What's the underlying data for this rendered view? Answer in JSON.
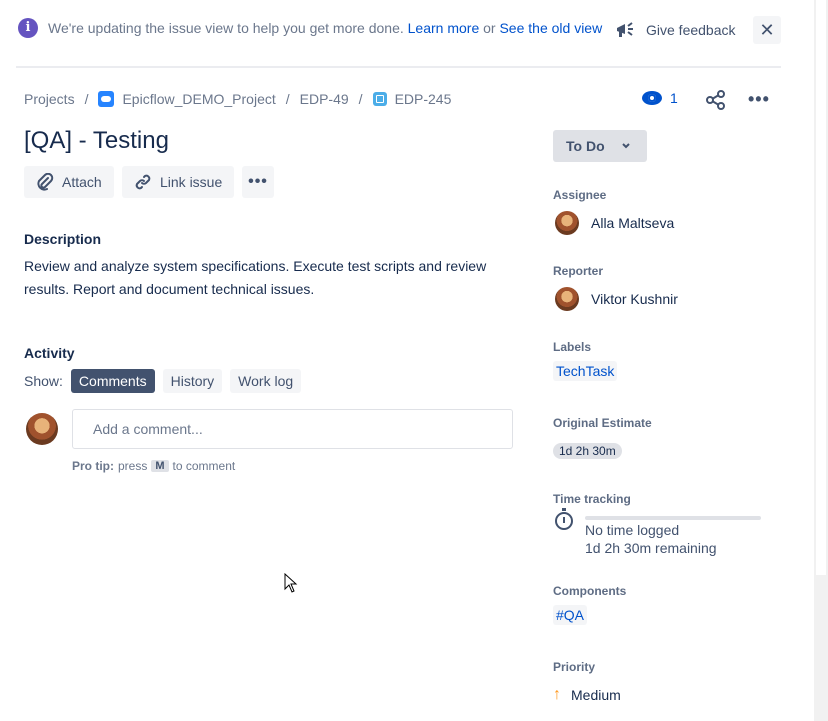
{
  "banner": {
    "message": "We're updating the issue view to help you get more done.",
    "learn_more": "Learn more",
    "or": "or",
    "old_view": "See the old view",
    "feedback": "Give feedback"
  },
  "breadcrumb": {
    "projects": "Projects",
    "project": "Epicflow_DEMO_Project",
    "parent": "EDP-49",
    "issue": "EDP-245",
    "sep": "/"
  },
  "watchers": "1",
  "issue": {
    "title": "[QA] - Testing",
    "attach_label": "Attach",
    "link_label": "Link issue",
    "description_heading": "Description",
    "description": "Review and analyze system specifications. Execute test scripts and review results. Report and document technical issues."
  },
  "activity": {
    "heading": "Activity",
    "show_label": "Show:",
    "tabs": [
      "Comments",
      "History",
      "Work log"
    ],
    "comment_placeholder": "Add a comment...",
    "tip_bold": "Pro tip:",
    "tip_press": "press",
    "tip_key": "M",
    "tip_rest": "to comment"
  },
  "sidebar": {
    "status": "To Do",
    "assignee_label": "Assignee",
    "assignee": "Alla Maltseva",
    "reporter_label": "Reporter",
    "reporter": "Viktor Kushnir",
    "labels_label": "Labels",
    "label": "TechTask",
    "estimate_label": "Original Estimate",
    "estimate": "1d 2h 30m",
    "time_label": "Time tracking",
    "time_logged": "No time logged",
    "time_remaining": "1d 2h 30m remaining",
    "components_label": "Components",
    "component": "#QA",
    "priority_label": "Priority",
    "priority": "Medium"
  },
  "colors": {
    "accent": "#0052cc",
    "banner_icon": "#6554c0",
    "priority_medium": "#ff991f"
  },
  "icons": [
    "info-icon",
    "megaphone-icon",
    "close-icon",
    "eye-icon",
    "share-icon",
    "more-icon",
    "paperclip-icon",
    "link-icon",
    "chevron-down-icon",
    "stopwatch-icon",
    "arrow-up-icon"
  ]
}
